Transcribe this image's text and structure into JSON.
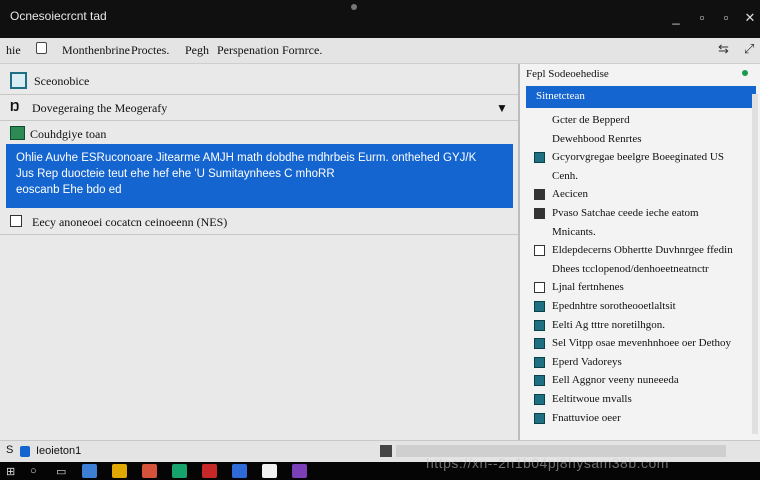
{
  "window": {
    "title": "Ocnesoiecrcnt tad"
  },
  "menubar": {
    "items": [
      "hie",
      "Monthenbrine",
      "Proctes.",
      "Pegh",
      "Perspenation",
      "Fornrce."
    ]
  },
  "left": {
    "header": "Sceonobice",
    "filter": "Dovegeraing the Meogerafy",
    "tree_item": "Couhdgiye toan",
    "selected_lines": [
      "Ohlie Auvhe ESRuconoare Jitearme AMJH math dobdhe mdhrbeis Eurm. onthehed GYJ/K",
      "Jus Rep duocteie teut ehe hef ehe 'U Sumitaynhees C mhoRR",
      "eoscanb Ehe bdo ed"
    ],
    "record": "Eecy anoneoei cocatcn ceinoeenn (NES)"
  },
  "right": {
    "header": "Fepl Sodeoehedise",
    "selected": "Sitnetctean",
    "items": [
      {
        "label": "Gcter de Bepperd",
        "icon": "none"
      },
      {
        "label": "Dewehbood Renrtes",
        "icon": "none"
      },
      {
        "label": "Gcyorvgregae beelgre Boeeginated US",
        "icon": "teal"
      },
      {
        "label": "Cenh.",
        "icon": "none"
      },
      {
        "label": "Aecicen",
        "icon": "dark"
      },
      {
        "label": "Pvaso Satchae ceede ieche eatom",
        "icon": "dark"
      },
      {
        "label": "Mnicants.",
        "icon": "none"
      },
      {
        "label": "Eldepdecerns Obhertte Duvhnrgee ffedin",
        "icon": "white"
      },
      {
        "label": "Dhees tcclopenod/denhoeetneatnctr",
        "icon": "none"
      },
      {
        "label": "Ljnal fertnhenes",
        "icon": "white"
      },
      {
        "label": "Epednhtre sorotheooetlaltsit",
        "icon": "teal"
      },
      {
        "label": "Eelti Ag tttre noretilhgon.",
        "icon": "teal"
      },
      {
        "label": "Sel Vitpp osae mevenhnhoee oer Dethoy",
        "icon": "teal"
      },
      {
        "label": "Eperd Vadoreys",
        "icon": "teal"
      },
      {
        "label": "Eell Aggnor veeny nuneeeda",
        "icon": "teal"
      },
      {
        "label": "Eeltitwoue mvalls",
        "icon": "teal"
      },
      {
        "label": "Fnattuvioe oeer",
        "icon": "teal"
      }
    ]
  },
  "status": {
    "text": "Ieoieton1"
  },
  "taskbar": {
    "icon_colors": [
      "#3d7fd4",
      "#e0a800",
      "#d4533a",
      "#17a36c",
      "#c62828",
      "#2f6bd6",
      "#f2f2f2",
      "#7b3fb8"
    ]
  },
  "watermark": "https://xn--2n1b04pj8hysam38b.com"
}
